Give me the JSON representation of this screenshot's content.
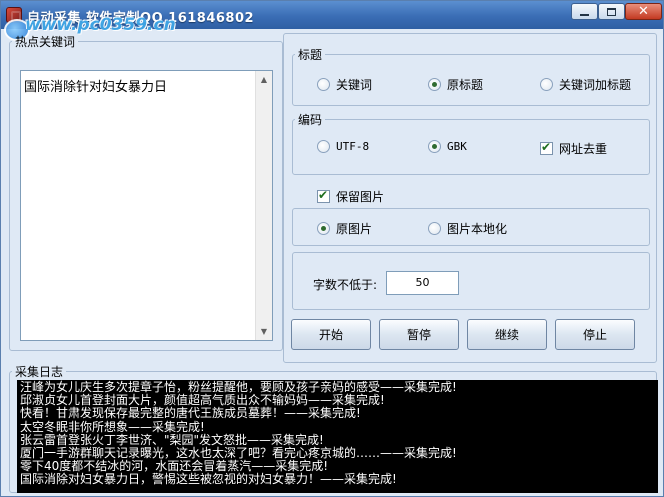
{
  "window": {
    "title": "自动采集 软件定制QQ 161846802",
    "watermark": "河东软件园",
    "watermark_url": "www.pc0359.cn"
  },
  "keywords": {
    "legend": "热点关键词",
    "text": "国际消除针对妇女暴力日"
  },
  "title_group": {
    "legend": "标题",
    "options": [
      "关键词",
      "原标题",
      "关键词加标题"
    ],
    "selected": "原标题"
  },
  "encode_group": {
    "legend": "编码",
    "options": [
      "UTF-8",
      "GBK"
    ],
    "selected": "GBK",
    "dedupe_label": "网址去重",
    "dedupe_checked": true
  },
  "images": {
    "keep_label": "保留图片",
    "keep_checked": true,
    "options": [
      "原图片",
      "图片本地化"
    ],
    "selected": "原图片"
  },
  "word_count": {
    "label": "字数不低于:",
    "value": "50"
  },
  "buttons": {
    "start": "开始",
    "pause": "暂停",
    "resume": "继续",
    "stop": "停止"
  },
  "log": {
    "legend": "采集日志",
    "lines": [
      "汪峰为女儿庆生多次提章子怡，粉丝提醒他，要顾及孩子亲妈的感受——采集完成!",
      "邱淑贞女儿首登封面大片，颜值超高气质出众不输妈妈——采集完成!",
      "快看！甘肃发现保存最完整的唐代王族成员墓葬！——采集完成!",
      "太空冬眠非你所想象——采集完成!",
      "张云雷首登张火丁李世济、\"梨园\"发文怒批——采集完成!",
      "厦门一手游群聊天记录曝光，这水也太深了吧？看完心疼京城的……——采集完成!",
      "零下40度都不结冰的河，水面还会冒着蒸汽——采集完成!",
      "国际消除对妇女暴力日，警惕这些被忽视的对妇女暴力！——采集完成!"
    ]
  }
}
